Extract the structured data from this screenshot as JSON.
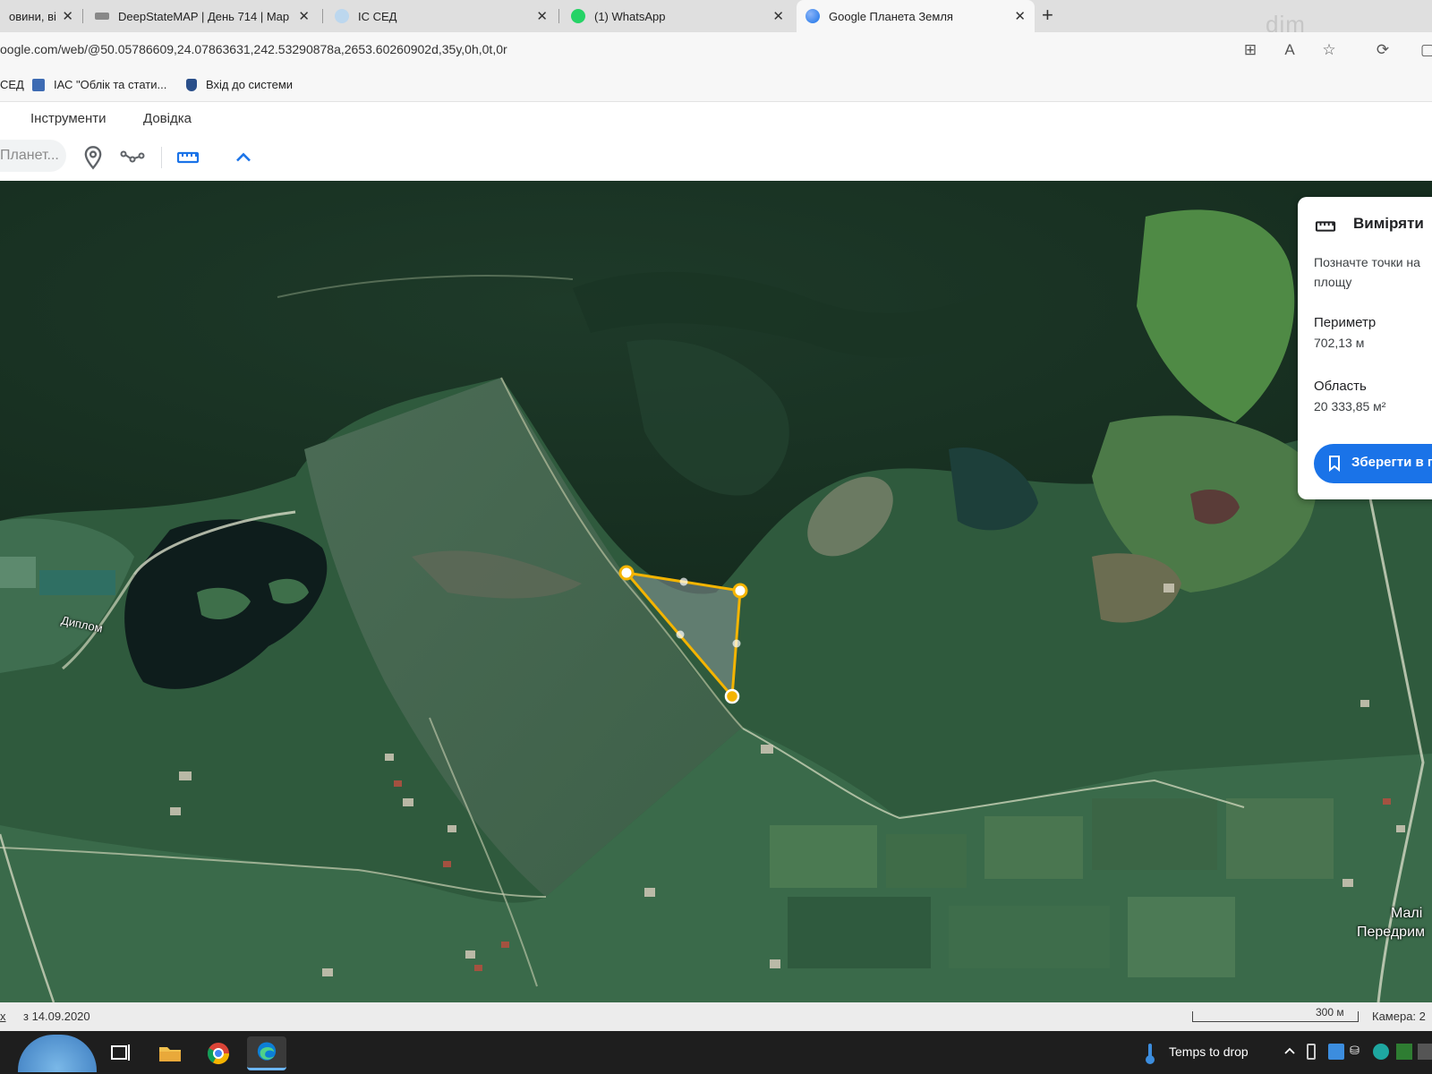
{
  "browser": {
    "tabs": [
      {
        "title": "овини, ві",
        "close": "✕"
      },
      {
        "title": "DeepStateMAP | День 714 | Map",
        "close": "✕"
      },
      {
        "title": "ІС СЕД",
        "close": "✕"
      },
      {
        "title": "(1) WhatsApp",
        "close": "✕"
      },
      {
        "title": "Google Планета Земля",
        "close": "✕"
      }
    ],
    "new_tab": "+",
    "url": "oogle.com/web/@50.05786609,24.07863631,242.53290878a,2653.60260902d,35y,0h,0t,0r",
    "watermark": "dim",
    "bookmarks": [
      {
        "label": "СЕД"
      },
      {
        "label": "ІАС \"Облік та стати..."
      },
      {
        "label": "Вхід до системи"
      }
    ]
  },
  "earth": {
    "menu": [
      "Інструменти",
      "Довідка"
    ],
    "search_placeholder": "Планет...",
    "map_labels": {
      "place1": "Диплом",
      "village_line1": "Малі",
      "village_line2": "Передрим"
    },
    "measure": {
      "title": "Виміряти",
      "hint": "Позначте точки на площу",
      "perimeter_label": "Периметр",
      "perimeter_value": "702,13 м",
      "area_label": "Область",
      "area_value": "20 333,85 м²",
      "save_button": "Зберегти в п"
    },
    "status": {
      "left_link": "х",
      "imagery_date": "з 14.09.2020",
      "scale": "300 м",
      "camera": "Камера: 2"
    }
  },
  "taskbar": {
    "weather": "Temps to drop"
  },
  "colors": {
    "accent": "#1a73e8",
    "measure_polygon": "#f4b400"
  }
}
